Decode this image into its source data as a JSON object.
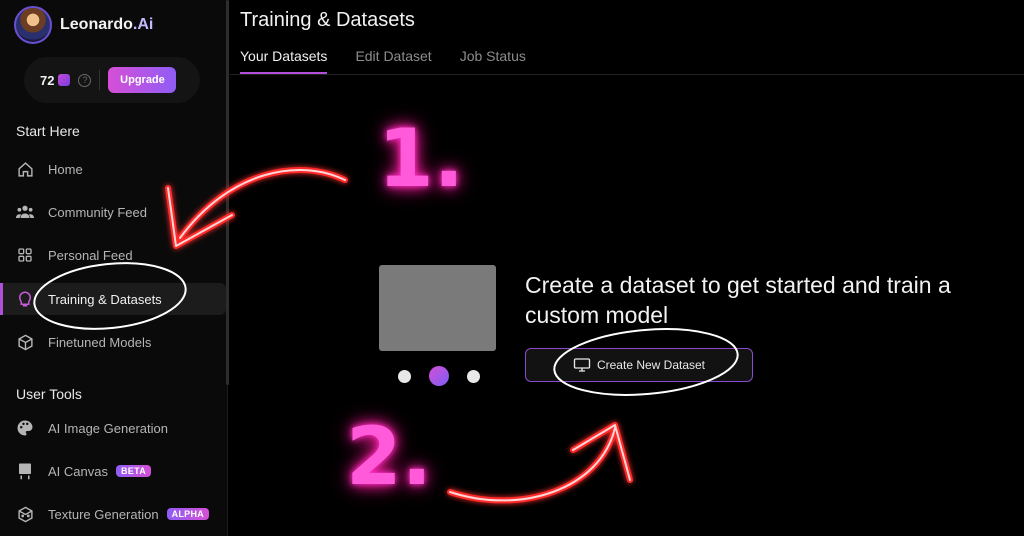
{
  "brand": {
    "name": "Leonardo",
    "suffix": ".Ai"
  },
  "tokens": {
    "count": "72",
    "help": "?",
    "upgrade_label": "Upgrade"
  },
  "sidebar": {
    "section_start": "Start Here",
    "start_items": [
      {
        "label": "Home",
        "icon": "home-icon"
      },
      {
        "label": "Community Feed",
        "icon": "community-icon"
      },
      {
        "label": "Personal Feed",
        "icon": "grid-icon"
      },
      {
        "label": "Training & Datasets",
        "icon": "training-icon",
        "active": true
      },
      {
        "label": "Finetuned Models",
        "icon": "cube-icon"
      }
    ],
    "section_tools": "User Tools",
    "tool_items": [
      {
        "label": "AI Image Generation",
        "icon": "palette-icon"
      },
      {
        "label": "AI Canvas",
        "icon": "canvas-icon",
        "badge": "BETA"
      },
      {
        "label": "Texture Generation",
        "icon": "texture-icon",
        "badge": "ALPHA"
      }
    ]
  },
  "main": {
    "title": "Training & Datasets",
    "tabs": [
      {
        "label": "Your Datasets",
        "active": true
      },
      {
        "label": "Edit Dataset"
      },
      {
        "label": "Job Status"
      }
    ],
    "empty_state": {
      "headline": "Create a dataset to get started and train a custom model",
      "button_label": "Create New Dataset"
    }
  },
  "annotations": {
    "step1": "1.",
    "step2": "2."
  },
  "colors": {
    "accent": "#b04fd8",
    "accent2": "#8f5df5",
    "neon": "#ff2fc8",
    "arrow": "#ff2a2a"
  }
}
